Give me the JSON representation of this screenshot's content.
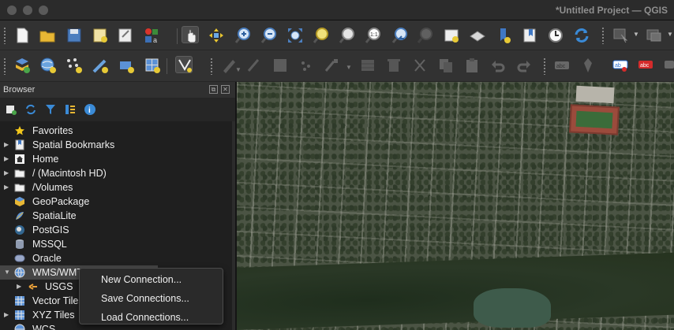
{
  "window": {
    "title": "*Untitled Project — QGIS"
  },
  "toolbar_project": {
    "buttons": [
      "new-project",
      "open-project",
      "save-project",
      "new-print-layout",
      "show-layout-manager",
      "style-manager",
      "pan-map",
      "pan-to-selection",
      "zoom-in",
      "zoom-out",
      "zoom-full",
      "zoom-to-selection",
      "zoom-to-layer",
      "zoom-native",
      "zoom-last",
      "zoom-next",
      "new-bookmark",
      "show-bookmarks",
      "new-spatial-bookmark",
      "temporal-controller",
      "refresh",
      "select-features",
      "attribute-table"
    ]
  },
  "toolbar_layers": {
    "buttons": [
      "data-source-manager",
      "new-geopackage-layer",
      "new-shapefile-layer",
      "new-temporary-layer",
      "new-virtual-layer",
      "add-vector-layer",
      "digitize",
      "current-edits",
      "toggle-editing",
      "save-layer-edits",
      "add-feature",
      "vertex-tool",
      "delete-selected",
      "cut-features",
      "copy-features",
      "paste-features",
      "undo",
      "redo",
      "label-toolbar",
      "pin-labels",
      "show-labels",
      "highlight-labels"
    ],
    "colors": {
      "label_red": "#d42b2b",
      "label_blue": "#2a6fd4"
    }
  },
  "browser": {
    "title": "Browser",
    "tree": [
      {
        "label": "Favorites",
        "icon": "star-icon",
        "expander": false
      },
      {
        "label": "Spatial Bookmarks",
        "icon": "bookmark-icon",
        "expander": true
      },
      {
        "label": "Home",
        "icon": "home-icon",
        "expander": true
      },
      {
        "label": "/ (Macintosh HD)",
        "icon": "folder-icon",
        "expander": true
      },
      {
        "label": "/Volumes",
        "icon": "folder-icon",
        "expander": true
      },
      {
        "label": "GeoPackage",
        "icon": "geopackage-icon",
        "expander": false
      },
      {
        "label": "SpatiaLite",
        "icon": "spatialite-icon",
        "expander": false
      },
      {
        "label": "PostGIS",
        "icon": "postgis-icon",
        "expander": false
      },
      {
        "label": "MSSQL",
        "icon": "mssql-icon",
        "expander": false
      },
      {
        "label": "Oracle",
        "icon": "oracle-icon",
        "expander": false
      },
      {
        "label": "WMS/WMTS",
        "icon": "globe-icon",
        "expander": true,
        "expanded": true,
        "selected": true
      },
      {
        "label": "USGS",
        "icon": "wms-layer-icon",
        "expander": true,
        "child": true
      },
      {
        "label": "Vector Tiles",
        "icon": "grid-icon",
        "expander": false
      },
      {
        "label": "XYZ Tiles",
        "icon": "grid-icon",
        "expander": true
      },
      {
        "label": "WCS",
        "icon": "globe-icon",
        "expander": false
      }
    ]
  },
  "context_menu": {
    "items": [
      "New Connection...",
      "Save Connections...",
      "Load Connections..."
    ]
  }
}
